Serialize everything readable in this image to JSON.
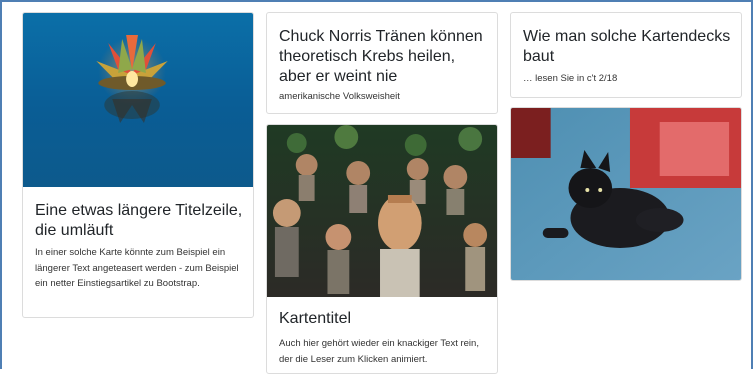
{
  "cards": [
    {
      "title": "Eine etwas längere Titelzeile, die umläuft",
      "text": "In einer solche Karte könnte zum Beispiel ein längerer Text angeteasert werden - zum Beispiel ein netter Einstiegsartikel zu Bootstrap.",
      "image": "floating-lantern-photo"
    },
    {
      "title": "Chuck Norris Tränen können theoretisch Krebs heilen, aber er weint nie",
      "text": "amerikanische Volksweisheit"
    },
    {
      "title": "Kartentitel",
      "text": "Auch hier gehört wieder ein knackiger Text rein, der die Leser zum Klicken animiert.",
      "image": "wooden-figures-photo"
    },
    {
      "title": "Wie man solche Kartendecks baut",
      "text": "… lesen Sie in c't 2/18"
    },
    {
      "image": "black-cat-photo"
    }
  ],
  "colors": {
    "frame": "#4f7fb4",
    "card_border": "#dcdcdc",
    "title": "#212529",
    "text": "#333333"
  }
}
